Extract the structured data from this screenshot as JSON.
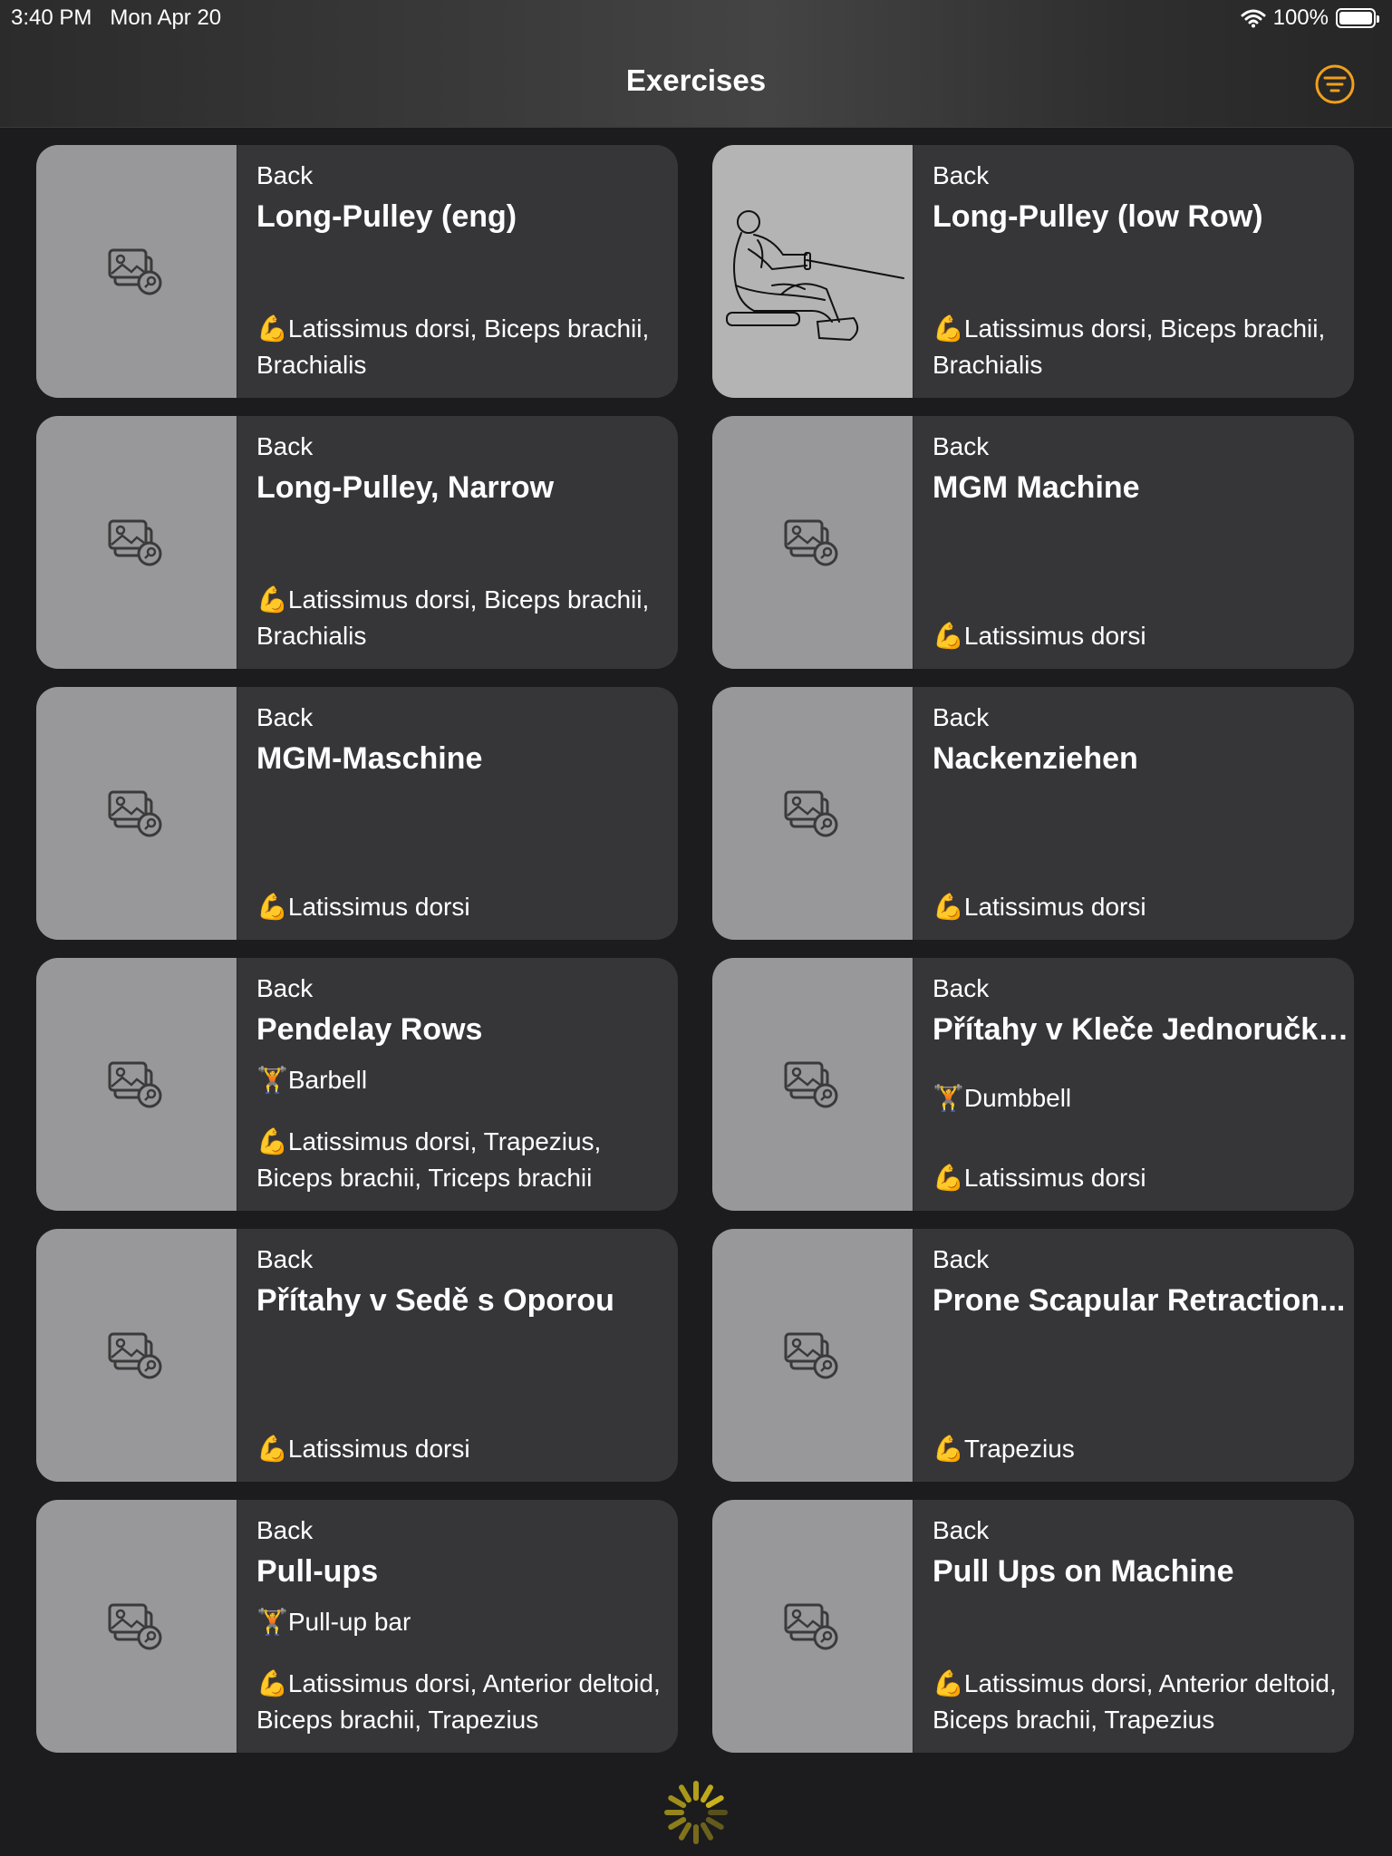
{
  "status_bar": {
    "time": "3:40 PM",
    "date": "Mon Apr 20",
    "battery": "100%"
  },
  "nav": {
    "title": "Exercises"
  },
  "colors": {
    "accent": "#f0a01a",
    "card": "#363639",
    "thumb": "#98989b"
  },
  "exercises": [
    {
      "category": "Back",
      "name": "Long-Pulley (eng)",
      "equipment": "",
      "muscles": "Latissimus dorsi, Biceps brachii, Brachialis",
      "image": "placeholder"
    },
    {
      "category": "Back",
      "name": "Long-Pulley (low Row)",
      "equipment": "",
      "muscles": "Latissimus dorsi, Biceps brachii, Brachialis",
      "image": "seated-row-drawing"
    },
    {
      "category": "Back",
      "name": "Long-Pulley, Narrow",
      "equipment": "",
      "muscles": "Latissimus dorsi, Biceps brachii, Brachialis",
      "image": "placeholder"
    },
    {
      "category": "Back",
      "name": "MGM Machine",
      "equipment": "",
      "muscles": "Latissimus dorsi",
      "image": "placeholder"
    },
    {
      "category": "Back",
      "name": "MGM-Maschine",
      "equipment": "",
      "muscles": "Latissimus dorsi",
      "image": "placeholder"
    },
    {
      "category": "Back",
      "name": "Nackenziehen",
      "equipment": "",
      "muscles": "Latissimus dorsi",
      "image": "placeholder"
    },
    {
      "category": "Back",
      "name": "Pendelay Rows",
      "equipment": "Barbell",
      "muscles": "Latissimus dorsi, Trapezius, Biceps brachii, Triceps brachii",
      "image": "placeholder"
    },
    {
      "category": "Back",
      "name": "Přítahy v Kleče Jednoručkou",
      "equipment": "Dumbbell",
      "muscles": "Latissimus dorsi",
      "image": "placeholder"
    },
    {
      "category": "Back",
      "name": "Přítahy v Sedě s Oporou",
      "equipment": "",
      "muscles": "Latissimus dorsi",
      "image": "placeholder"
    },
    {
      "category": "Back",
      "name": "Prone Scapular Retraction...",
      "equipment": "",
      "muscles": "Trapezius",
      "image": "placeholder"
    },
    {
      "category": "Back",
      "name": "Pull-ups",
      "equipment": "Pull-up bar",
      "muscles": "Latissimus dorsi, Anterior deltoid, Biceps brachii, Trapezius",
      "image": "placeholder"
    },
    {
      "category": "Back",
      "name": "Pull Ups on Machine",
      "equipment": "",
      "muscles": "Latissimus dorsi, Anterior deltoid, Biceps brachii, Trapezius",
      "image": "placeholder"
    }
  ],
  "icons": {
    "muscle": "💪",
    "equipment": "🏋"
  }
}
